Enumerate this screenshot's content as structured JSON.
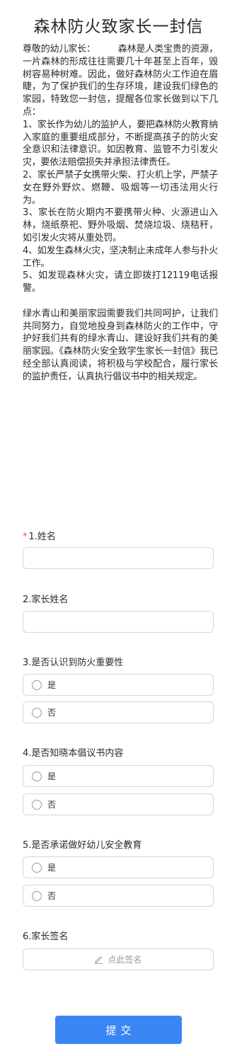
{
  "title": "森林防火致家长一封信",
  "letter": {
    "paragraphs": [
      "尊敬的幼儿家长：        森林是人类宝贵的资源，一片森林的形成往往需要几十年甚至上百年，毁树容易种树难。因此，做好森林防火工作迫在眉睫，为了保护我们的生存环境，建设我们绿色的家园，特致您一封信，提醒各位家长做到以下几点：",
      "1、家长作为幼儿的监护人，要把森林防火教育纳入家庭的重要组成部分，不断提高孩子的防火安全意识和法律意识。如因教育、监管不力引发火灾，要依法赔偿损失并承担法律责任。",
      "2、家长严禁子女携带火柴、打火机上学，严禁子女在野外野炊、燃鞭、吸烟等一切违法用火行为。",
      "3、家长在防火期内不要携带火种、火源进山入林，烧纸祭祀、野外吸烟、焚烧垃圾、烧秸秆，如引发火灾将从重处罚。",
      "4、如发生森林火灾，坚决制止未成年人参与扑火工作。",
      "5、如发现森林火灾，请立即拨打12119电话报警。",
      "",
      "绿水青山和美丽家园需要我们共同呵护，让我们共同努力，自觉地投身到森林防火的工作中，守护好我们共有的绿水青山、建设好我们共有的美丽家园。《森林防火安全致学生家长一封信》我已经全部认真阅读，将积极与学校配合，履行家长的监护责任，认真执行倡议书中的相关规定。"
    ]
  },
  "form": {
    "q1": {
      "required_mark": "*",
      "label": "1.姓名",
      "value": ""
    },
    "q2": {
      "label": "2.家长姓名",
      "value": ""
    },
    "q3": {
      "label": "3.是否认识到防火重要性",
      "options": [
        "是",
        "否"
      ]
    },
    "q4": {
      "label": "4.是否知晓本倡议书内容",
      "options": [
        "是",
        "否"
      ]
    },
    "q5": {
      "label": "5.是否承诺做好幼儿安全教育",
      "options": [
        "是",
        "否"
      ]
    },
    "q6": {
      "label": "6.家长签名",
      "sign_placeholder": "点此签名"
    },
    "submit_label": "提交"
  },
  "colors": {
    "accent": "#3b86f5",
    "required": "#ef4b4b",
    "border": "#d6d6d6"
  },
  "icons": {
    "radio": "radio-circle-icon",
    "pen": "pen-icon"
  }
}
